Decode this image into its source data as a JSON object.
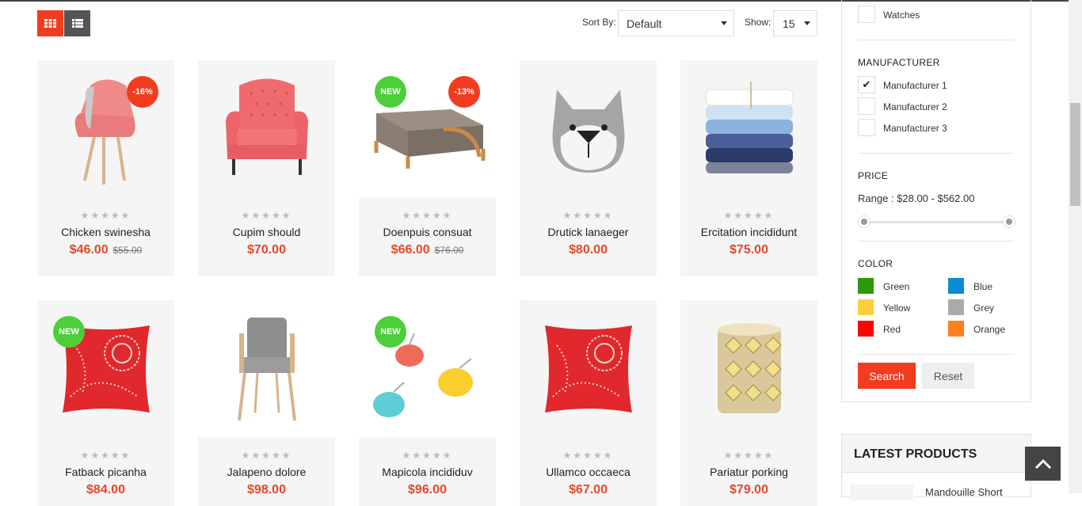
{
  "toolbar": {
    "sort_label": "Sort By:",
    "sort_value": "Default",
    "show_label": "Show:",
    "show_value": "15"
  },
  "products": [
    {
      "name": "Chicken swinesha",
      "price": "$46.00",
      "old_price": "$55.00",
      "badges": [
        "-16%"
      ],
      "icon": "armchair-image"
    },
    {
      "name": "Cupim should",
      "price": "$70.00",
      "old_price": "",
      "badges": [],
      "icon": "tufted-armchair-image"
    },
    {
      "name": "Doenpuis consuat",
      "price": "$66.00",
      "old_price": "$76.00",
      "badges": [
        "NEW",
        "-13%"
      ],
      "icon": "ottoman-image"
    },
    {
      "name": "Drutick lanaeger",
      "price": "$80.00",
      "old_price": "",
      "badges": [],
      "icon": "dog-pillow-image"
    },
    {
      "name": "Ercitation incididunt",
      "price": "$75.00",
      "old_price": "",
      "badges": [],
      "icon": "towels-image"
    },
    {
      "name": "Fatback picanha",
      "price": "$84.00",
      "old_price": "",
      "badges": [
        "NEW"
      ],
      "icon": "red-pillow-image"
    },
    {
      "name": "Jalapeno dolore",
      "price": "$98.00",
      "old_price": "",
      "badges": [],
      "icon": "grey-chair-image"
    },
    {
      "name": "Mapicola incididuv",
      "price": "$96.00",
      "old_price": "",
      "badges": [
        "NEW"
      ],
      "icon": "bird-hooks-image"
    },
    {
      "name": "Ullamco occaeca",
      "price": "$67.00",
      "old_price": "",
      "badges": [],
      "icon": "red-pillow-image"
    },
    {
      "name": "Pariatur porking",
      "price": "$79.00",
      "old_price": "",
      "badges": [],
      "icon": "candle-holder-image"
    }
  ],
  "sidebar": {
    "category_last": {
      "label": "Watches",
      "checked": false
    },
    "manufacturer": {
      "title": "MANUFACTURER",
      "items": [
        {
          "label": "Manufacturer 1",
          "checked": true
        },
        {
          "label": "Manufacturer 2",
          "checked": false
        },
        {
          "label": "Manufacturer 3",
          "checked": false
        }
      ]
    },
    "price": {
      "title": "PRICE",
      "range": "Range : $28.00 - $562.00"
    },
    "color": {
      "title": "COLOR",
      "items": [
        {
          "label": "Green",
          "hex": "#2a9a07"
        },
        {
          "label": "Blue",
          "hex": "#0a8bd2"
        },
        {
          "label": "Yellow",
          "hex": "#fdce3b"
        },
        {
          "label": "Grey",
          "hex": "#aaaaaa"
        },
        {
          "label": "Red",
          "hex": "#ff0000"
        },
        {
          "label": "Orange",
          "hex": "#ff7f1e"
        }
      ]
    },
    "search_label": "Search",
    "reset_label": "Reset",
    "latest": {
      "title": "LATEST PRODUCTS",
      "first_item": "Mandouille Short"
    }
  },
  "colors": {
    "accent": "#f23c1f",
    "price": "#e8462b",
    "new_badge": "#4ccf3a"
  }
}
